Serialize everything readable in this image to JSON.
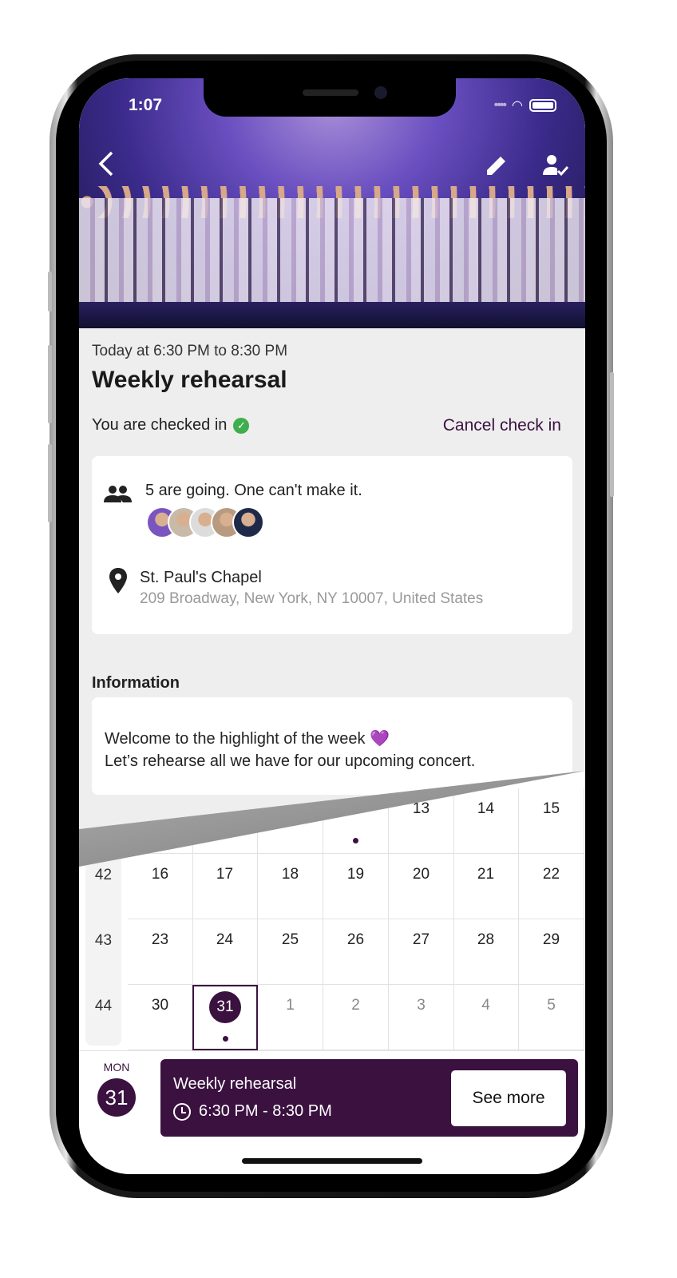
{
  "status_bar": {
    "time": "1:07"
  },
  "header": {
    "back_icon": "chevron-left-icon",
    "edit_icon": "pencil-icon",
    "attendance_icon": "person-check-icon"
  },
  "event": {
    "when": "Today at 6:30 PM to 8:30 PM",
    "title": "Weekly rehearsal",
    "checked_in_text": "You are checked in",
    "cancel_label": "Cancel check in",
    "attendance": "5 are going. One can't make it.",
    "avatar_count": 5,
    "location_name": "St. Paul's Chapel",
    "location_address": "209 Broadway, New York, NY 10007, United States",
    "info_heading": "Information",
    "info_line1": "Welcome to the highlight of the week 💜",
    "info_line2": "Let’s rehearse all we have for our upcoming concert."
  },
  "calendar": {
    "rows": [
      {
        "week": "",
        "days": [
          "",
          "",
          "",
          "",
          "13",
          "14",
          "15"
        ],
        "dots": [
          3
        ]
      },
      {
        "week": "42",
        "days": [
          "16",
          "17",
          "18",
          "19",
          "20",
          "21",
          "22"
        ],
        "dots": []
      },
      {
        "week": "43",
        "days": [
          "23",
          "24",
          "25",
          "26",
          "27",
          "28",
          "29"
        ],
        "dots": []
      },
      {
        "week": "44",
        "days": [
          "30",
          "31",
          "1",
          "2",
          "3",
          "4",
          "5"
        ],
        "dots": [
          1
        ],
        "selected": 1,
        "muted_from": 2
      }
    ]
  },
  "selected_day": {
    "weekday": "MON",
    "day": "31"
  },
  "event_preview": {
    "title": "Weekly rehearsal",
    "time": "6:30 PM - 8:30 PM",
    "button": "See more"
  },
  "colors": {
    "brand": "#3b1140",
    "check": "#3fae4e",
    "page_bg": "#eeeeee"
  }
}
